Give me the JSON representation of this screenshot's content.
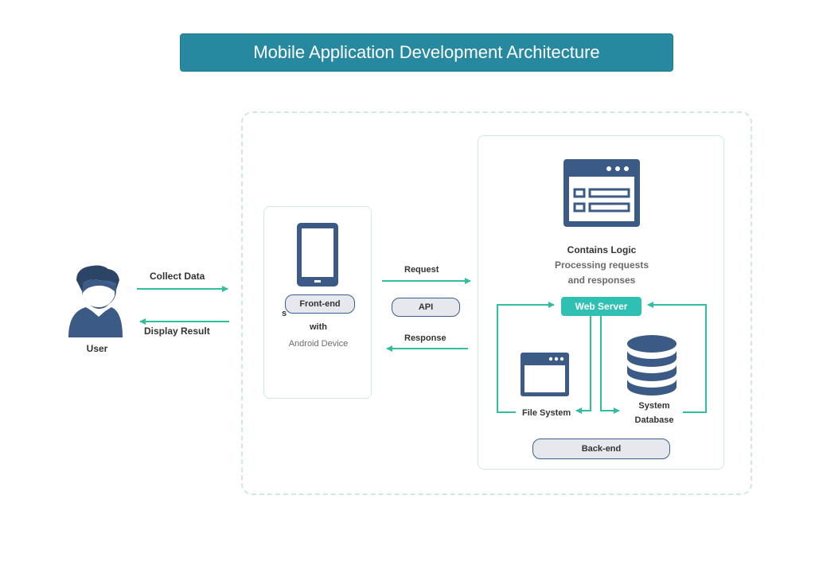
{
  "title": "Mobile Application Development Architecture",
  "user": {
    "label": "User"
  },
  "arrows": {
    "collect_data": "Collect Data",
    "display_result": "Display Result",
    "request": "Request",
    "response": "Response"
  },
  "frontend": {
    "badge": "Front-end",
    "line_partial": "s",
    "line_with": "with",
    "line_device": "Android Device"
  },
  "api": {
    "label": "API"
  },
  "backend": {
    "heading": "Contains Logic",
    "desc_line1": "Processing requests",
    "desc_line2": "and responses",
    "web_server": "Web Server",
    "file_system": "File System",
    "db_line1": "System",
    "db_line2": "Database",
    "badge": "Back-end"
  },
  "colors": {
    "banner": "#27899f",
    "arrow": "#2fbfa0",
    "icon": "#3b5a85",
    "web_server": "#2fbfb3",
    "panel_border": "#cfe8e3"
  }
}
